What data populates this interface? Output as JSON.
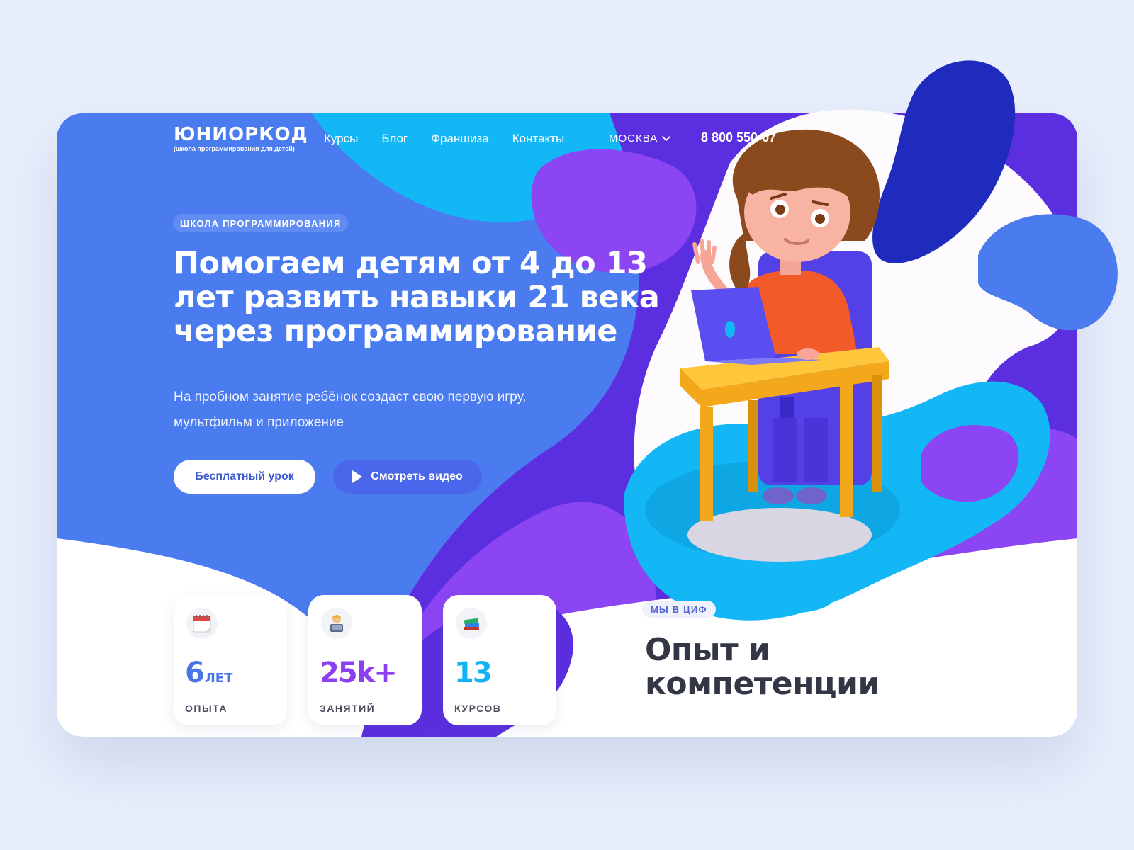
{
  "logo": {
    "name": "ЮНИОРКОД",
    "tagline": "(школа программирования для детей)"
  },
  "nav": {
    "items": [
      "Курсы",
      "Блог",
      "Франшиза",
      "Контакты"
    ]
  },
  "city": {
    "label": "МОСКВА",
    "icon": "chevron-down-icon"
  },
  "phone": "8 800 550-07",
  "hero": {
    "badge": "ШКОЛА ПРОГРАММИРОВАНИЯ",
    "title": "Помогаем детям от 4 до 13 лет развить навыки 21 века через программирование",
    "subtitle": "На пробном занятие ребёнок создаст свою первую игру, мультфильм и приложение",
    "primary_button": "Бесплатный урок",
    "video_button": "Смотреть видео"
  },
  "stats": [
    {
      "icon": "calendar-icon",
      "value": "6",
      "unit": "лет",
      "label": "ОПЫТА",
      "color": "#4a74e8"
    },
    {
      "icon": "developer-icon",
      "value": "25k+",
      "unit": "",
      "label": "ЗАНЯТИЙ",
      "color": "#8b3ff0"
    },
    {
      "icon": "books-icon",
      "value": "13",
      "unit": "",
      "label": "КУРСОВ",
      "color": "#12b3f2"
    }
  ],
  "numbers_section": {
    "badge": "МЫ В ЦИФ",
    "title": "Опыт и компетенции"
  },
  "colors": {
    "page_bg": "#e8eefb",
    "hero_blue": "#4a7cf0",
    "purple": "#5b2ee0",
    "violet": "#8b45f2",
    "cyan": "#14b7f5",
    "dark_blue": "#1f2bbd"
  }
}
